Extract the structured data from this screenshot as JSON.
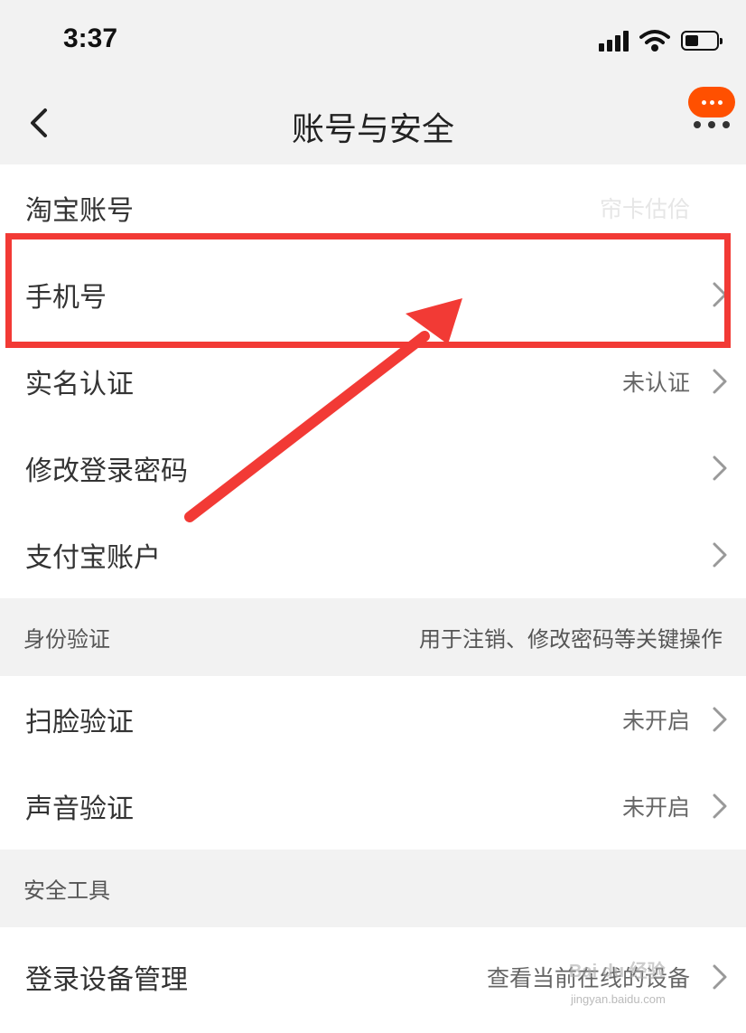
{
  "status_bar": {
    "time": "3:37",
    "icons": [
      "signal-icon",
      "wifi-icon",
      "battery-icon"
    ],
    "battery_level": 0.45
  },
  "nav": {
    "title": "账号与安全",
    "back_icon": "chevron-left-icon",
    "more_icon": "more-icon",
    "more_accent": "#ff5000"
  },
  "account_group": {
    "rows": [
      {
        "label": "淘宝账号",
        "value": "帘卡估佮"
      },
      {
        "label": "手机号",
        "value": ""
      },
      {
        "label": "实名认证",
        "value": "未认证"
      },
      {
        "label": "修改登录密码",
        "value": ""
      },
      {
        "label": "支付宝账户",
        "value": ""
      }
    ]
  },
  "identity_section": {
    "title": "身份验证",
    "note": "用于注销、修改密码等关键操作",
    "rows": [
      {
        "label": "扫脸验证",
        "value": "未开启"
      },
      {
        "label": "声音验证",
        "value": "未开启"
      }
    ]
  },
  "tools_section": {
    "title": "安全工具",
    "rows": [
      {
        "label": "登录设备管理",
        "value": "查看当前在线的设备"
      }
    ]
  },
  "annotation": {
    "color": "#f23a35"
  },
  "watermark": {
    "text": "Bai du 经验",
    "sub": "jingyan.baidu.com"
  }
}
